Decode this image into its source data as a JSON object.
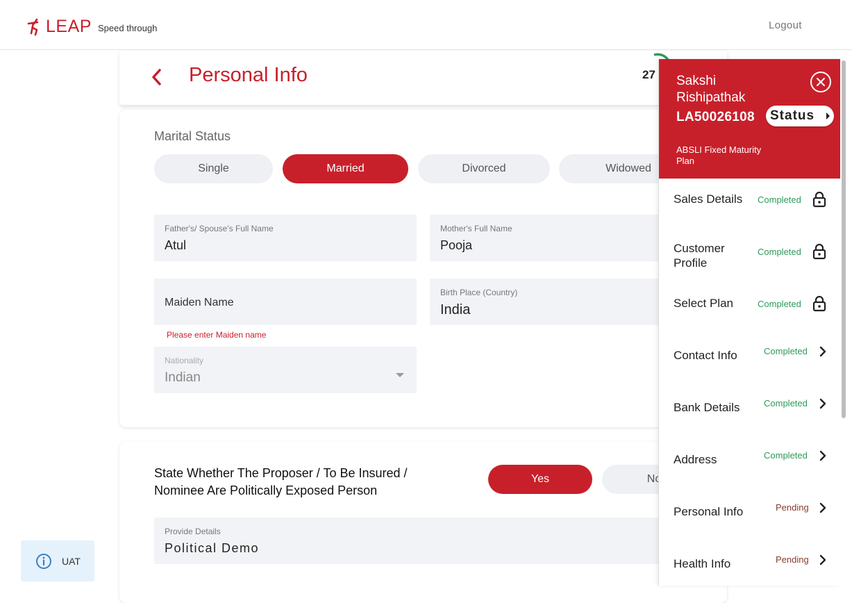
{
  "header": {
    "logo_text": "LEAP",
    "tagline": "Speed through",
    "logout_label": "Logout"
  },
  "page": {
    "title": "Personal Info",
    "progress_value": "27"
  },
  "marital": {
    "label": "Marital Status",
    "options": [
      "Single",
      "Married",
      "Divorced",
      "Widowed"
    ],
    "selected": "Married"
  },
  "form": {
    "father_spouse": {
      "label": "Father's/ Spouse's Full Name",
      "value": "Atul"
    },
    "mother": {
      "label": "Mother's Full Name",
      "value": "Pooja"
    },
    "maiden": {
      "placeholder": "Maiden Name",
      "error": "Please enter Maiden name"
    },
    "birth_place": {
      "label": "Birth Place (Country)",
      "value": "India"
    },
    "nationality": {
      "label": "Nationality",
      "value": "Indian"
    }
  },
  "pep": {
    "question": "State Whether The Proposer / To Be Insured / Nominee Are Politically Exposed Person",
    "yes_label": "Yes",
    "no_label": "No",
    "details_label": "Provide Details",
    "details_value": "Political Demo"
  },
  "env_badge": {
    "label": "UAT"
  },
  "side_panel": {
    "customer_name": "Sakshi Rishipathak",
    "application_no": "LA50026108",
    "plan_name": "ABSLI Fixed Maturity Plan",
    "status_label": "Status",
    "steps": [
      {
        "name": "Sales Details",
        "status": "Completed",
        "icon": "lock-icon"
      },
      {
        "name": "Customer Profile",
        "status": "Completed",
        "icon": "lock-icon"
      },
      {
        "name": "Select Plan",
        "status": "Completed",
        "icon": "lock-icon"
      },
      {
        "name": "Contact Info",
        "status": "Completed",
        "icon": "chevron-right-icon"
      },
      {
        "name": "Bank Details",
        "status": "Completed",
        "icon": "chevron-right-icon"
      },
      {
        "name": "Address",
        "status": "Completed",
        "icon": "chevron-right-icon"
      },
      {
        "name": "Personal Info",
        "status": "Pending",
        "icon": "chevron-right-icon"
      },
      {
        "name": "Health Info",
        "status": "Pending",
        "icon": "chevron-right-icon"
      }
    ]
  },
  "colors": {
    "brand_red": "#c8202b",
    "completed_green": "#2e9a5a",
    "pending_brown": "#8a3a2c",
    "field_bg": "#f2f3f6"
  }
}
